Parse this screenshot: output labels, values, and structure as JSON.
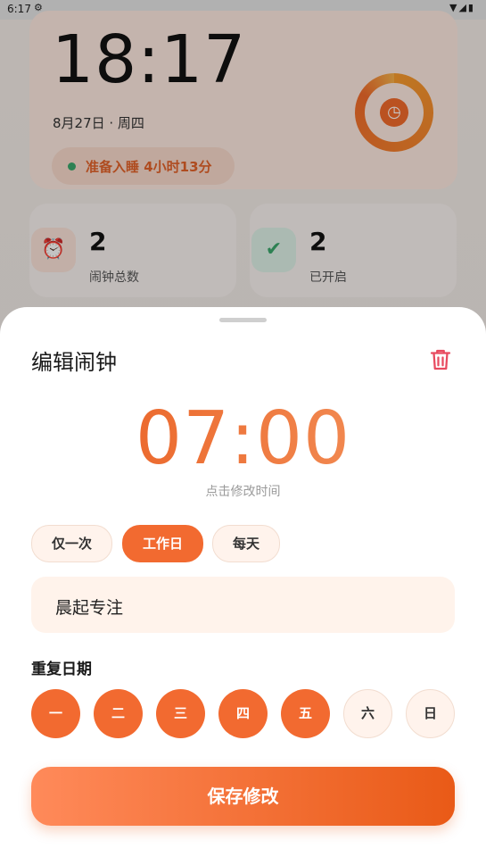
{
  "status_bar": {
    "time": "6:17"
  },
  "background": {
    "clock_time": "18:17",
    "date": "8月27日 · 周四",
    "sleep_badge": "准备入睡  4小时13分",
    "stats": [
      {
        "value": "2",
        "label": "闹钟总数"
      },
      {
        "value": "2",
        "label": "已开启"
      }
    ]
  },
  "sheet": {
    "title": "编辑闹钟",
    "time": "07:00",
    "hint": "点击修改时间",
    "presets": [
      {
        "label": "仅一次",
        "active": false
      },
      {
        "label": "工作日",
        "active": true
      },
      {
        "label": "每天",
        "active": false
      }
    ],
    "alarm_label": "晨起专注",
    "repeat_title": "重复日期",
    "days": [
      {
        "label": "一",
        "on": true
      },
      {
        "label": "二",
        "on": true
      },
      {
        "label": "三",
        "on": true
      },
      {
        "label": "四",
        "on": true
      },
      {
        "label": "五",
        "on": true
      },
      {
        "label": "六",
        "on": false
      },
      {
        "label": "日",
        "on": false
      }
    ],
    "save_label": "保存修改"
  },
  "colors": {
    "accent": "#f26a30",
    "delete": "#e84a5f",
    "active_green": "#3aa66b"
  }
}
